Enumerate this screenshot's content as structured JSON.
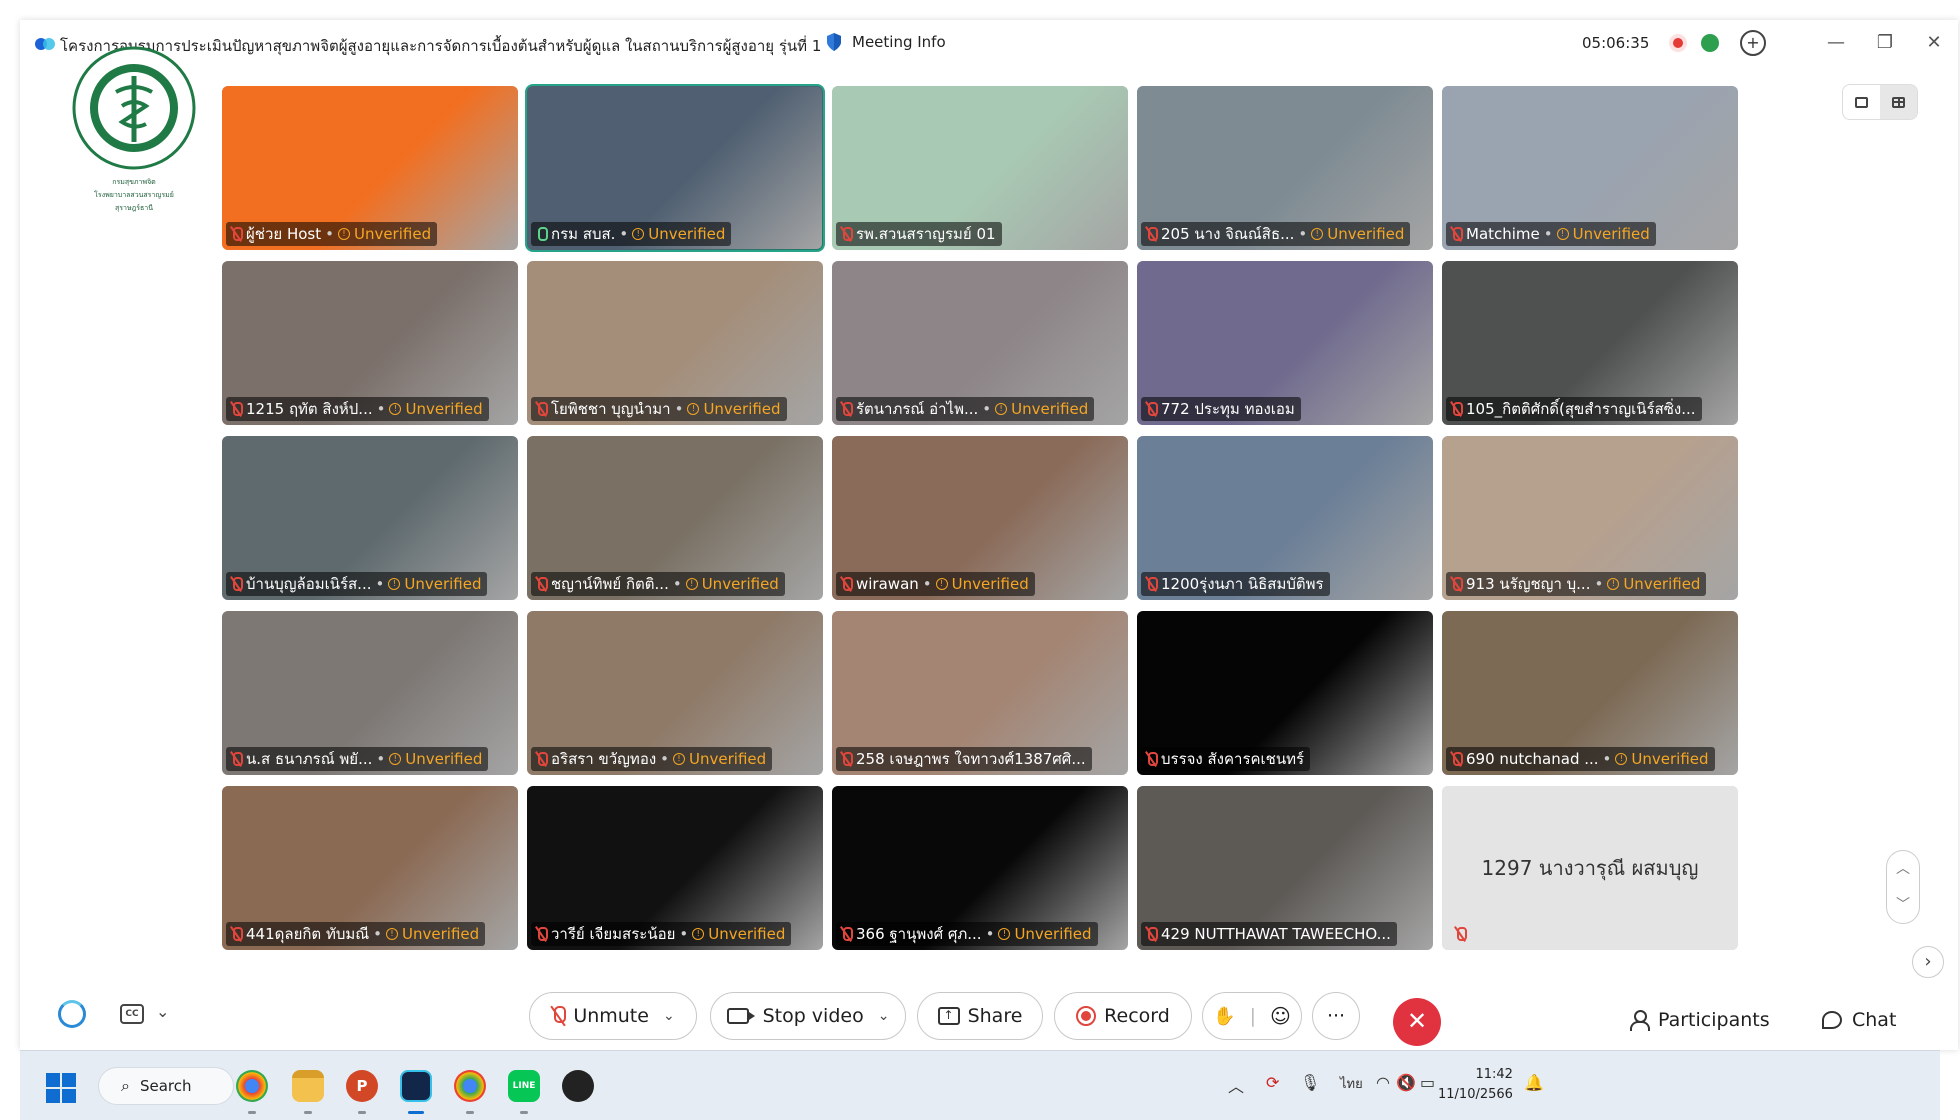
{
  "window": {
    "title": "โครงการอบรมการประเมินปัญหาสุขภาพจิตผู้สูงอายุและการจัดการเบื้องต้นสำหรับผู้ดูแล ในสถานบริการผู้สูงอายุ รุ่นที่ 1",
    "meeting_info_label": "Meeting Info",
    "elapsed_time": "05:06:35",
    "minimize": "—",
    "restore": "❐",
    "close": "✕"
  },
  "logo": {
    "caption_line1": "กรมสุขภาพจิต",
    "caption_line2": "โรงพยาบาลสวนสราญรมย์",
    "caption_line3": "สุราษฎร์ธานี"
  },
  "tiles": [
    {
      "name": "ผู้ช่วย Host",
      "unverified": "Unverified",
      "mic": "off",
      "bg": "#f26f21"
    },
    {
      "name": "กรม สบส.",
      "unverified": "Unverified",
      "mic": "on",
      "bg": "#506072",
      "active": true
    },
    {
      "name": "รพ.สวนสราญรมย์ 01",
      "unverified": "",
      "mic": "off",
      "bg": "#a8c9b3"
    },
    {
      "name": "205 นาง จิณณ์สิธ...",
      "unverified": "Unverified",
      "mic": "off",
      "bg": "#7e8b93"
    },
    {
      "name": "Matchime",
      "unverified": "Unverified",
      "mic": "off",
      "bg": "#9aa3b0"
    },
    {
      "name": "1215 ฤทัต สิงห์ป...",
      "unverified": "Unverified",
      "mic": "off",
      "bg": "#7b706a"
    },
    {
      "name": "โยพิชชา บุญนำมา",
      "unverified": "Unverified",
      "mic": "off",
      "bg": "#a48e7a"
    },
    {
      "name": "รัตนาภรณ์ อ่าไพ...",
      "unverified": "Unverified",
      "mic": "off",
      "bg": "#8d8587"
    },
    {
      "name": "772 ประทุม ทองเอม",
      "unverified": "",
      "mic": "off",
      "bg": "#6f6a8e"
    },
    {
      "name": "105_กิตติศักดิ์(สุขสำราญเนิร์สซิ่ง...",
      "unverified": "",
      "mic": "off",
      "bg": "#4e5150"
    },
    {
      "name": "บ้านบุญล้อมเนิร์ส...",
      "unverified": "Unverified",
      "mic": "off",
      "bg": "#5e6a6e"
    },
    {
      "name": "ชญาน์ทิพย์  กิตติ...",
      "unverified": "Unverified",
      "mic": "off",
      "bg": "#7a7164"
    },
    {
      "name": "wirawan",
      "unverified": "Unverified",
      "mic": "off",
      "bg": "#8a6a58"
    },
    {
      "name": "1200รุ่งนภา นิธิสมบัติพร",
      "unverified": "",
      "mic": "off",
      "bg": "#6b7f97"
    },
    {
      "name": "913 นรัญชญา บุ...",
      "unverified": "Unverified",
      "mic": "off",
      "bg": "#b6a08e"
    },
    {
      "name": "น.ส ธนาภรณ์ พยั...",
      "unverified": "Unverified",
      "mic": "off",
      "bg": "#7d7874"
    },
    {
      "name": "อริสรา ขวัญทอง",
      "unverified": "Unverified",
      "mic": "off",
      "bg": "#8f7a68"
    },
    {
      "name": "258 เจษฎาพร ใจทาวงศ์1387ศศิ...",
      "unverified": "",
      "mic": "off",
      "bg": "#a48472"
    },
    {
      "name": "บรรจง สังคารคเชนทร์",
      "unverified": "",
      "mic": "off",
      "bg": "#050505"
    },
    {
      "name": "690 nutchanad ...",
      "unverified": "Unverified",
      "mic": "off",
      "bg": "#7d6a55"
    },
    {
      "name": "441ดุลยกิต ทับมณี",
      "unverified": "Unverified",
      "mic": "off",
      "bg": "#8b6a54"
    },
    {
      "name": "วารีย์ เจียมสระน้อย",
      "unverified": "Unverified",
      "mic": "off",
      "bg": "#111111"
    },
    {
      "name": "366 ฐานุพงศ์ ศุภ...",
      "unverified": "Unverified",
      "mic": "off",
      "bg": "#080808"
    },
    {
      "name": "429 NUTTHAWAT TAWEECHO...",
      "unverified": "",
      "mic": "off",
      "bg": "#5d5a56"
    },
    {
      "name": "1297 นางวารุณี ผสมบุญ",
      "unverified": "",
      "mic": "off",
      "bg": "#e4e4e4",
      "avatar_only": true
    }
  ],
  "toolbar": {
    "unmute": "Unmute",
    "stop_video": "Stop video",
    "share": "Share",
    "record": "Record",
    "more": "···",
    "participants": "Participants",
    "chat": "Chat",
    "cc": "CC"
  },
  "taskbar": {
    "search": "Search",
    "language": "ไทย",
    "time": "11:42",
    "date": "11/10/2566"
  },
  "colors": {
    "accent_green": "#27a38a",
    "end_red": "#e0323f",
    "unverified_orange": "#f5a623",
    "mic_off_red": "#e0463c"
  }
}
